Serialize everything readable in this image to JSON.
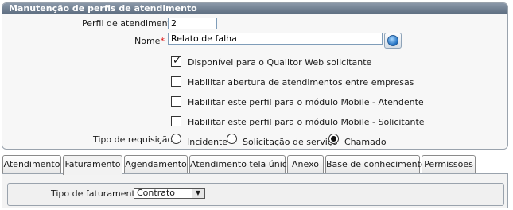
{
  "panel": {
    "title": "Manutenção de perfis de atendimento",
    "perfil_label": "Perfil de atendimento :",
    "perfil_value": "2",
    "nome_label": "Nome",
    "nome_required": "*",
    "nome_colon": ":",
    "nome_value": "Relato de falha"
  },
  "checkboxes": [
    {
      "label": "Disponível para o Qualitor Web solicitante",
      "checked": true
    },
    {
      "label": "Habilitar abertura de atendimentos entre empresas",
      "checked": false
    },
    {
      "label": "Habilitar este perfil para o módulo Mobile - Atendente",
      "checked": false
    },
    {
      "label": "Habilitar este perfil para o módulo Mobile - Solicitante",
      "checked": false
    }
  ],
  "requisicao": {
    "label": "Tipo de requisição :",
    "options": [
      {
        "label": "Incidente",
        "checked": false
      },
      {
        "label": "Solicitação de serviço",
        "checked": false
      },
      {
        "label": "Chamado",
        "checked": true
      }
    ]
  },
  "tabs": [
    {
      "label": "Atendimento",
      "active": false
    },
    {
      "label": "Faturamento",
      "active": true
    },
    {
      "label": "Agendamento",
      "active": false
    },
    {
      "label": "Atendimento tela única",
      "active": false
    },
    {
      "label": "Anexo",
      "active": false
    },
    {
      "label": "Base de conhecimento",
      "active": false
    },
    {
      "label": "Permissões",
      "active": false
    }
  ],
  "faturamento": {
    "label": "Tipo de faturamento :",
    "selected": "Contrato",
    "arrow": "▼"
  },
  "icons": {
    "globe": "globe-icon"
  }
}
